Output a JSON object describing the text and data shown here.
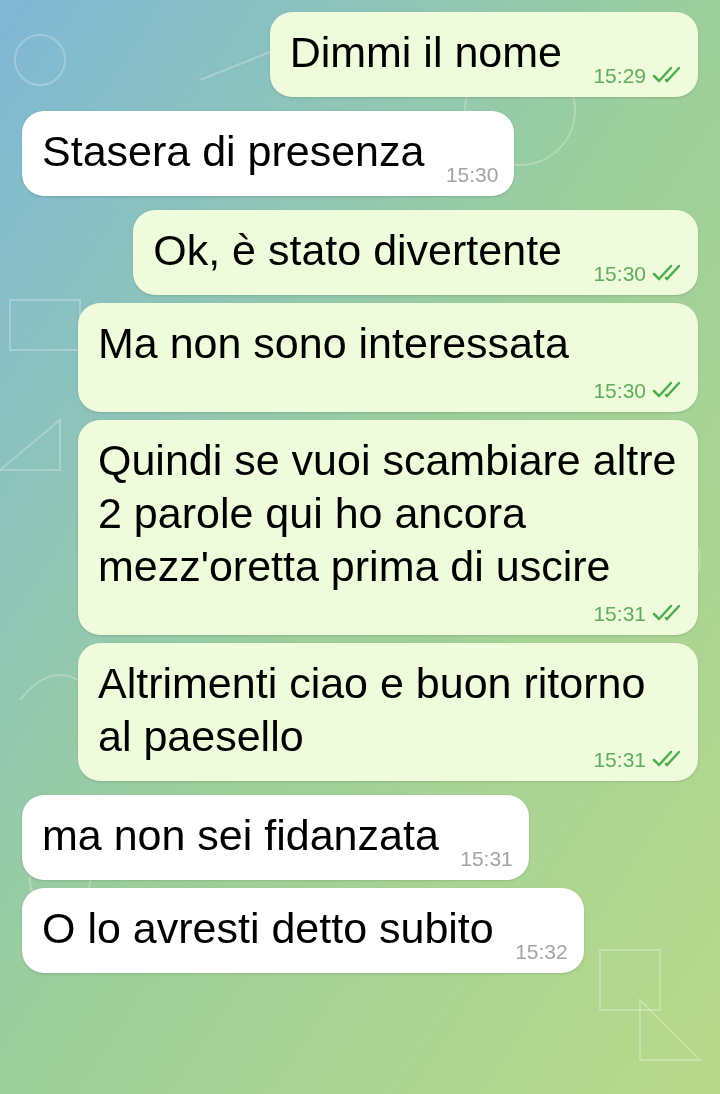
{
  "messages": [
    {
      "kind": "outgoing",
      "text": "Dimmi il nome",
      "time": "15:29",
      "read": true
    },
    {
      "kind": "incoming",
      "text": "Stasera di presenza",
      "time": "15:30"
    },
    {
      "kind": "outgoing",
      "text": "Ok, è stato divertente",
      "time": "15:30",
      "read": true
    },
    {
      "kind": "outgoing",
      "text": "Ma non sono interessata",
      "time": "15:30",
      "read": true
    },
    {
      "kind": "outgoing",
      "text": "Quindi se vuoi scambiare altre 2 parole qui ho ancora mezz'oretta prima di uscire",
      "time": "15:31",
      "read": true
    },
    {
      "kind": "outgoing",
      "text": "Altrimenti ciao e buon ritorno al paesello",
      "time": "15:31",
      "read": true
    },
    {
      "kind": "incoming",
      "text": "ma non sei fidanzata",
      "time": "15:31"
    },
    {
      "kind": "incoming",
      "text": "O lo avresti detto subito",
      "time": "15:32"
    }
  ]
}
